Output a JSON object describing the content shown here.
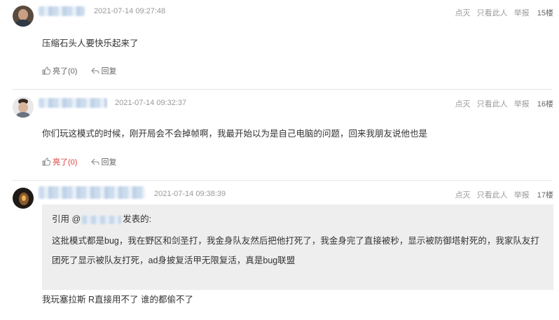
{
  "posts": [
    {
      "time": "2021-07-14 09:27:48",
      "ops": {
        "flag": "点灭",
        "only_author": "只看此人",
        "report": "举报",
        "floor": "15楼"
      },
      "content": "压缩石头人要快乐起来了",
      "like_label": "亮了(0)",
      "reply_label": "回复"
    },
    {
      "time": "2021-07-14 09:32:37",
      "ops": {
        "flag": "点灭",
        "only_author": "只看此人",
        "report": "举报",
        "floor": "16楼"
      },
      "content": "你们玩这模式的时候，刚开局会不会掉帧啊，我最开始以为是自己电脑的问题，回来我朋友说他也是",
      "like_label": "亮了(0)",
      "reply_label": "回复"
    },
    {
      "time": "2021-07-14 09:38:39",
      "ops": {
        "flag": "点灭",
        "only_author": "只看此人",
        "report": "举报",
        "floor": "17楼"
      },
      "quote": {
        "prefix": "引用 @",
        "suffix": "发表的:",
        "line1": "这批模式都是bug，我在野区和剑圣打，我金身队友然后把他打死了，我金身完了直接被秒，显示被防御塔射死的，我家队友打",
        "line2": "团死了显示被队友打死，ad身披复活甲无限复活，真是bug联盟"
      },
      "content": "我玩塞拉斯 R直接用不了 谁的都偷不了"
    }
  ]
}
